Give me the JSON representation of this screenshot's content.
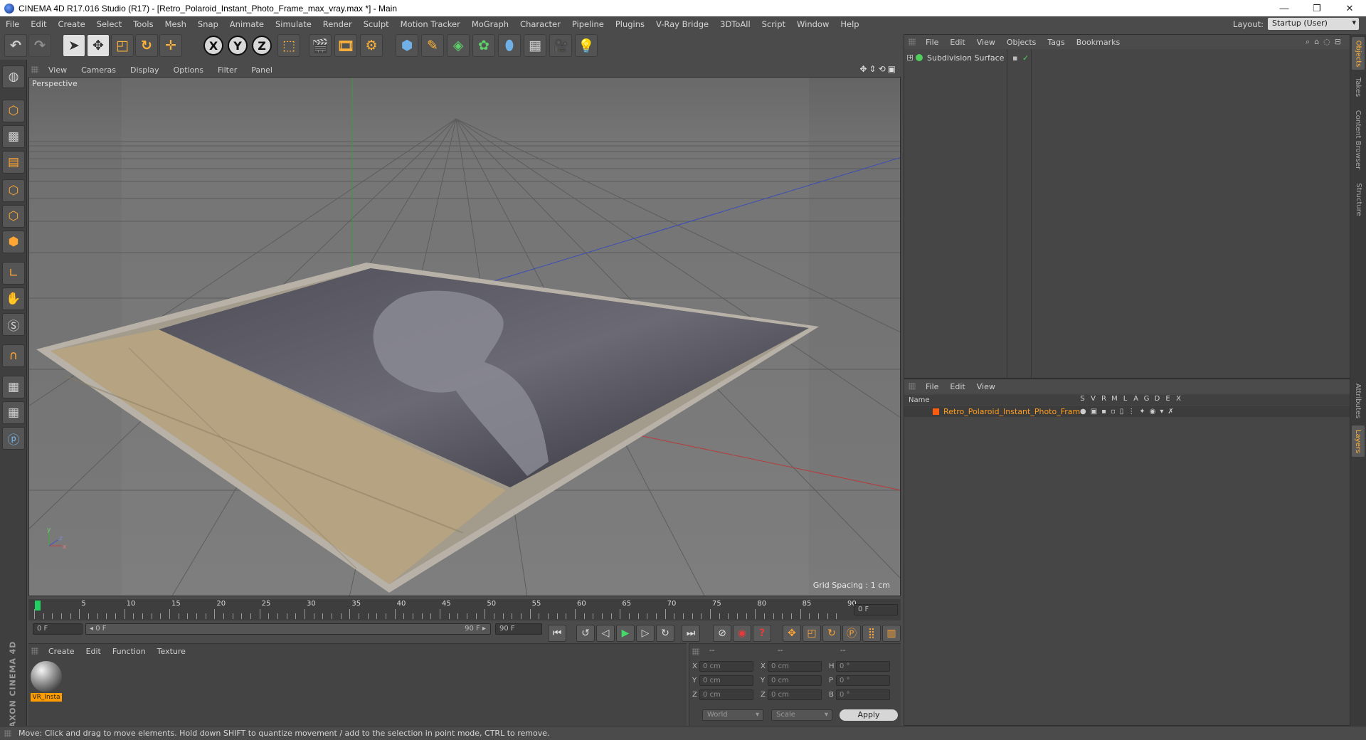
{
  "window": {
    "title": "CINEMA 4D R17.016 Studio (R17) - [Retro_Polaroid_Instant_Photo_Frame_max_vray.max *] - Main",
    "controls": [
      "—",
      "❐",
      "✕"
    ]
  },
  "menubar": {
    "items": [
      "File",
      "Edit",
      "Create",
      "Select",
      "Tools",
      "Mesh",
      "Snap",
      "Animate",
      "Simulate",
      "Render",
      "Sculpt",
      "Motion Tracker",
      "MoGraph",
      "Character",
      "Pipeline",
      "Plugins",
      "V-Ray Bridge",
      "3DToAll",
      "Script",
      "Window",
      "Help"
    ],
    "layout_label": "Layout:",
    "layout_value": "Startup (User)"
  },
  "toolbar": {
    "x_label": "X",
    "y_label": "Y",
    "z_label": "Z"
  },
  "viewport": {
    "menu": [
      "View",
      "Cameras",
      "Display",
      "Options",
      "Filter",
      "Panel"
    ],
    "label": "Perspective",
    "grid_spacing": "Grid Spacing : 1 cm",
    "axis_y": "y",
    "axis_z": "z",
    "axis_x": "x"
  },
  "timeline": {
    "ticks": [
      "0",
      "5",
      "10",
      "15",
      "20",
      "25",
      "30",
      "35",
      "40",
      "45",
      "50",
      "55",
      "60",
      "65",
      "70",
      "75",
      "80",
      "85",
      "90"
    ],
    "current_frame": "0 F",
    "start_field": "0 F",
    "range_start": "◂ 0 F",
    "range_end": "90 F ▸",
    "end_field": "90 F"
  },
  "material_panel": {
    "menu": [
      "Create",
      "Edit",
      "Function",
      "Texture"
    ],
    "materials": [
      {
        "label": "VR_Insta"
      }
    ]
  },
  "coordinates": {
    "headers": [
      "--",
      "--",
      "--"
    ],
    "rows": [
      {
        "l1": "X",
        "v1": "0 cm",
        "l2": "X",
        "v2": "0 cm",
        "l3": "H",
        "v3": "0 °"
      },
      {
        "l1": "Y",
        "v1": "0 cm",
        "l2": "Y",
        "v2": "0 cm",
        "l3": "P",
        "v3": "0 °"
      },
      {
        "l1": "Z",
        "v1": "0 cm",
        "l2": "Z",
        "v2": "0 cm",
        "l3": "B",
        "v3": "0 °"
      }
    ],
    "mode_dropdown": "World",
    "scale_dropdown": "Scale",
    "apply_label": "Apply"
  },
  "status": {
    "text": "Move: Click and drag to move elements. Hold down SHIFT to quantize movement / add to the selection in point mode, CTRL to remove."
  },
  "object_manager": {
    "menu": [
      "File",
      "Edit",
      "View",
      "Objects",
      "Tags",
      "Bookmarks"
    ],
    "objects": [
      {
        "name": "Subdivision Surface"
      }
    ]
  },
  "layer_manager": {
    "menu": [
      "File",
      "Edit",
      "View"
    ],
    "name_header": "Name",
    "columns": [
      "S",
      "V",
      "R",
      "M",
      "L",
      "A",
      "G",
      "D",
      "E",
      "X"
    ],
    "layers": [
      {
        "name": "Retro_Polaroid_Instant_Photo_Frame",
        "color": "#ff5c10"
      }
    ]
  },
  "right_tabs": [
    "Objects",
    "Takes",
    "Content Browser",
    "Structure",
    "Attributes",
    "Layers"
  ],
  "branding": "MAXON CINEMA 4D",
  "colors": {
    "accent": "#ffa533",
    "active_layer": "#ff9d1c",
    "play": "#45d96a",
    "record": "#e63b3b"
  }
}
